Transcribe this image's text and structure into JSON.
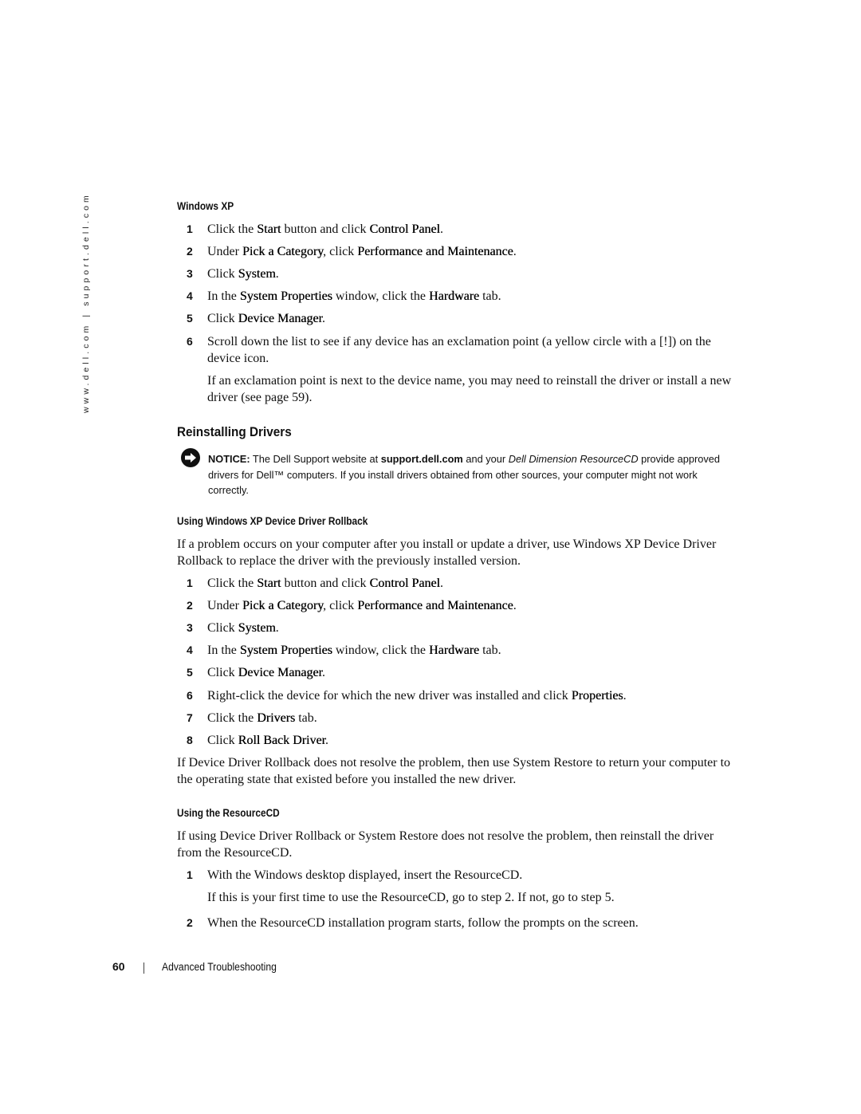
{
  "side_url": "www.dell.com | support.dell.com",
  "windows_xp": {
    "heading": "Windows XP",
    "steps": [
      {
        "num": "1",
        "parts": [
          "Click the ",
          "Start",
          " button and click ",
          "Control Panel",
          "."
        ]
      },
      {
        "num": "2",
        "parts": [
          "Under ",
          "Pick a Category",
          ", click ",
          "Performance and Maintenance",
          "."
        ]
      },
      {
        "num": "3",
        "parts": [
          "Click ",
          "System",
          "."
        ]
      },
      {
        "num": "4",
        "parts": [
          "In the ",
          "System Properties",
          " window, click the ",
          "Hardware",
          " tab."
        ]
      },
      {
        "num": "5",
        "parts": [
          "Click ",
          "Device Manager",
          "."
        ]
      },
      {
        "num": "6",
        "parts": [
          "Scroll down the list to see if any device has an exclamation point (a yellow circle with a [!]) on the device icon."
        ]
      }
    ],
    "step6_followup": "If an exclamation point is next to the device name, you may need to reinstall the driver or install a new driver (see page 59)."
  },
  "reinstalling": {
    "heading": "Reinstalling Drivers",
    "notice": {
      "icon": "notice-arrow-icon",
      "label": "NOTICE:",
      "text_1": " The Dell Support website at ",
      "link": "support.dell.com",
      "text_2": " and your ",
      "italic": "Dell Dimension ResourceCD",
      "text_3": " provide approved drivers for Dell™ computers. If you install drivers obtained from other sources, your computer might not work correctly."
    }
  },
  "rollback": {
    "heading": "Using Windows XP Device Driver Rollback",
    "intro": "If a problem occurs on your computer after you install or update a driver, use Windows XP Device Driver Rollback to replace the driver with the previously installed version.",
    "steps": [
      {
        "num": "1",
        "parts": [
          "Click the ",
          "Start",
          " button and click ",
          "Control Panel",
          "."
        ]
      },
      {
        "num": "2",
        "parts": [
          "Under ",
          "Pick a Category",
          ", click ",
          "Performance and Maintenance",
          "."
        ]
      },
      {
        "num": "3",
        "parts": [
          "Click ",
          "System",
          "."
        ]
      },
      {
        "num": "4",
        "parts": [
          "In the ",
          "System Properties",
          " window, click the ",
          "Hardware",
          " tab."
        ]
      },
      {
        "num": "5",
        "parts": [
          "Click ",
          "Device Manager",
          "."
        ]
      },
      {
        "num": "6",
        "parts": [
          "Right-click the device for which the new driver was installed and click ",
          "Properties",
          "."
        ]
      },
      {
        "num": "7",
        "parts": [
          "Click the ",
          "Drivers",
          " tab."
        ]
      },
      {
        "num": "8",
        "parts": [
          "Click ",
          "Roll Back Driver",
          "."
        ]
      }
    ],
    "outro": "If Device Driver Rollback does not resolve the problem, then use System Restore to return your computer to the operating state that existed before you installed the new driver."
  },
  "resourcecd": {
    "heading": "Using the ResourceCD",
    "intro": "If using Device Driver Rollback or System Restore does not resolve the problem, then reinstall the driver from the ResourceCD.",
    "steps": [
      {
        "num": "1",
        "parts": [
          "With the Windows desktop displayed, insert the ResourceCD."
        ]
      },
      {
        "num": "2",
        "parts": [
          "When the ResourceCD installation program starts, follow the prompts on the screen."
        ]
      }
    ],
    "step1_followup": "If this is your first time to use the ResourceCD, go to step 2. If not, go to step 5."
  },
  "footer": {
    "page_number": "60",
    "section_title": "Advanced Troubleshooting"
  }
}
